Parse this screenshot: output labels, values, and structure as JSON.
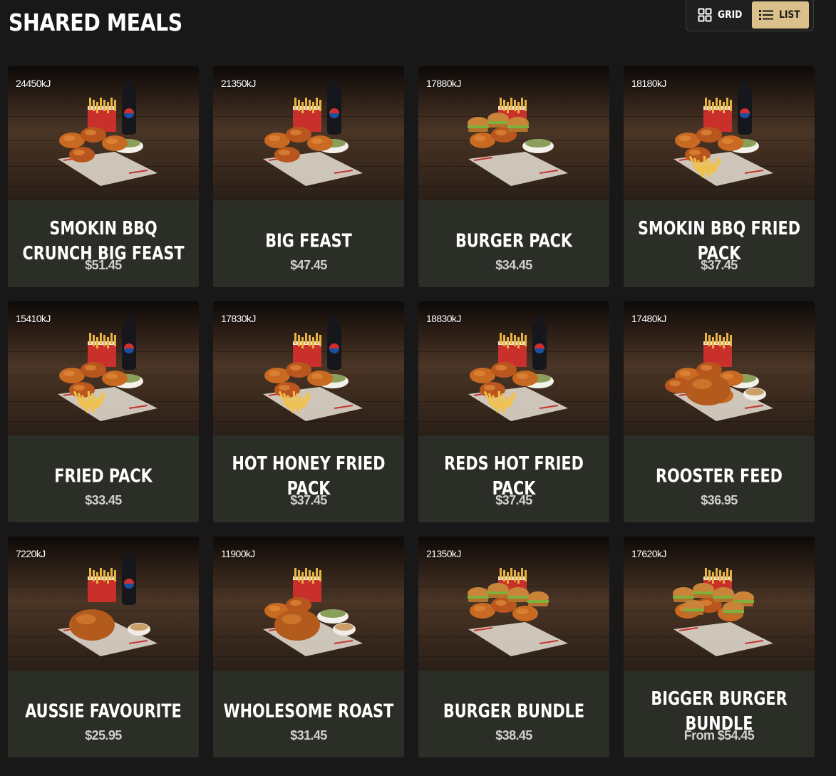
{
  "section": {
    "title": "SHARED MEALS"
  },
  "view_toggle": {
    "grid_label": "GRID",
    "list_label": "LIST",
    "active": "list",
    "active_color": "#dcc08c"
  },
  "colors": {
    "background": "#181818",
    "card_body": "#2b2d27",
    "text": "#ffffff",
    "price_text": "#d0d0d0"
  },
  "products": [
    {
      "energy": "24450kJ",
      "name": "SMOKIN BBQ CRUNCH BIG FEAST",
      "price": "$51.45",
      "image": "meal-photo"
    },
    {
      "energy": "21350kJ",
      "name": "BIG FEAST",
      "price": "$47.45",
      "image": "meal-photo"
    },
    {
      "energy": "17880kJ",
      "name": "BURGER PACK",
      "price": "$34.45",
      "image": "meal-photo"
    },
    {
      "energy": "18180kJ",
      "name": "SMOKIN BBQ FRIED PACK",
      "price": "$37.45",
      "image": "meal-photo"
    },
    {
      "energy": "15410kJ",
      "name": "FRIED PACK",
      "price": "$33.45",
      "image": "meal-photo"
    },
    {
      "energy": "17830kJ",
      "name": "HOT HONEY FRIED PACK",
      "price": "$37.45",
      "image": "meal-photo"
    },
    {
      "energy": "18830kJ",
      "name": "REDS HOT FRIED PACK",
      "price": "$37.45",
      "image": "meal-photo"
    },
    {
      "energy": "17480kJ",
      "name": "ROOSTER FEED",
      "price": "$36.95",
      "image": "meal-photo"
    },
    {
      "energy": "7220kJ",
      "name": "AUSSIE FAVOURITE",
      "price": "$25.95",
      "image": "meal-photo"
    },
    {
      "energy": "11900kJ",
      "name": "WHOLESOME ROAST",
      "price": "$31.45",
      "image": "meal-photo"
    },
    {
      "energy": "21350kJ",
      "name": "BURGER BUNDLE",
      "price": "$38.45",
      "image": "meal-photo"
    },
    {
      "energy": "17620kJ",
      "name": "BIGGER BURGER BUNDLE",
      "price": "From $54.45",
      "image": "meal-photo"
    }
  ]
}
